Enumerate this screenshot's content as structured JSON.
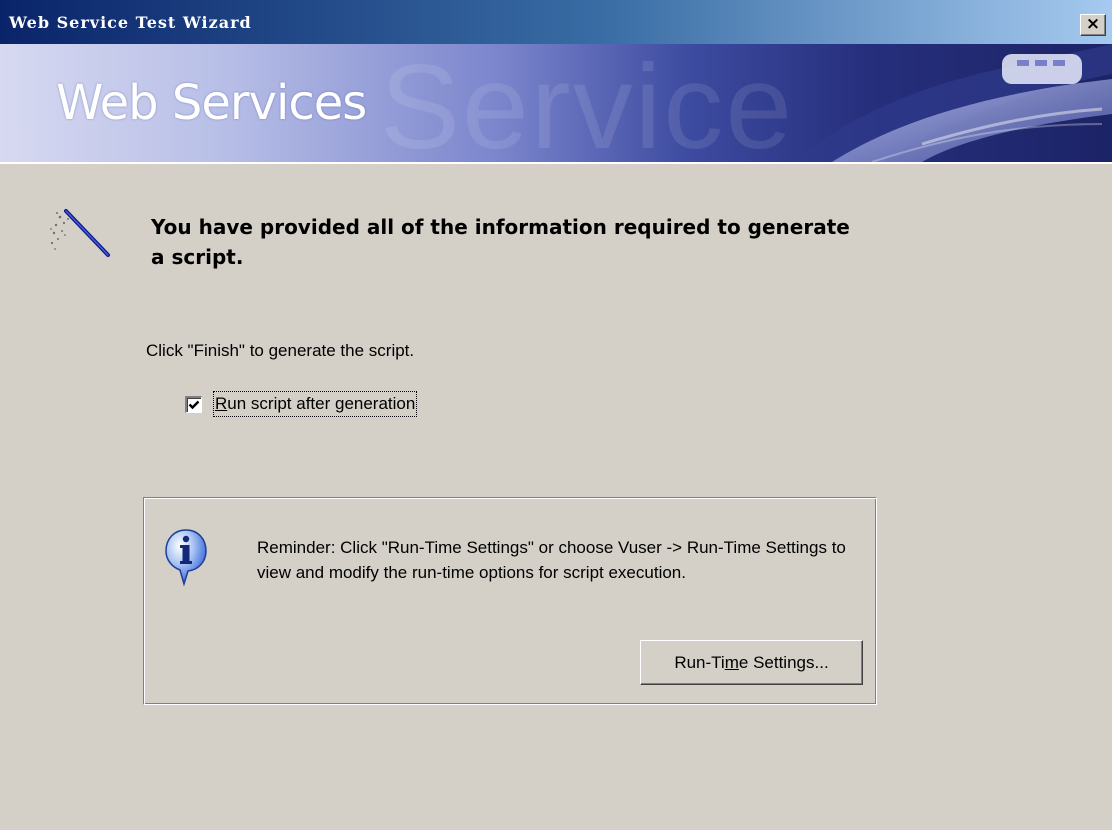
{
  "window": {
    "title": "Web Service Test Wizard",
    "close_glyph": "×"
  },
  "banner": {
    "title": "Web Services",
    "watermark": "Service"
  },
  "content": {
    "heading": "You have provided all of the information required to generate a script.",
    "instruction": "Click \"Finish\" to generate the script.",
    "checkbox": {
      "label_mnemonic": "R",
      "label_rest": "un script after generation",
      "checked": true
    }
  },
  "reminder": {
    "text": "Reminder: Click \"Run-Time Settings\" or choose Vuser -> Run-Time Settings to view and modify the run-time options for script execution.",
    "button": {
      "label_before": "Run-Ti",
      "label_mnemonic": "m",
      "label_after": "e Settings..."
    }
  },
  "icons": {
    "wand": "magic-wand-icon",
    "info": "info-icon",
    "close": "close-icon",
    "check": "checkmark-icon"
  },
  "colors": {
    "dialog_background": "#d4d0c8",
    "titlebar_start": "#0a246a",
    "titlebar_end": "#a6caf0",
    "banner_dark": "#1c2366",
    "info_blue": "#2a5bd7"
  }
}
